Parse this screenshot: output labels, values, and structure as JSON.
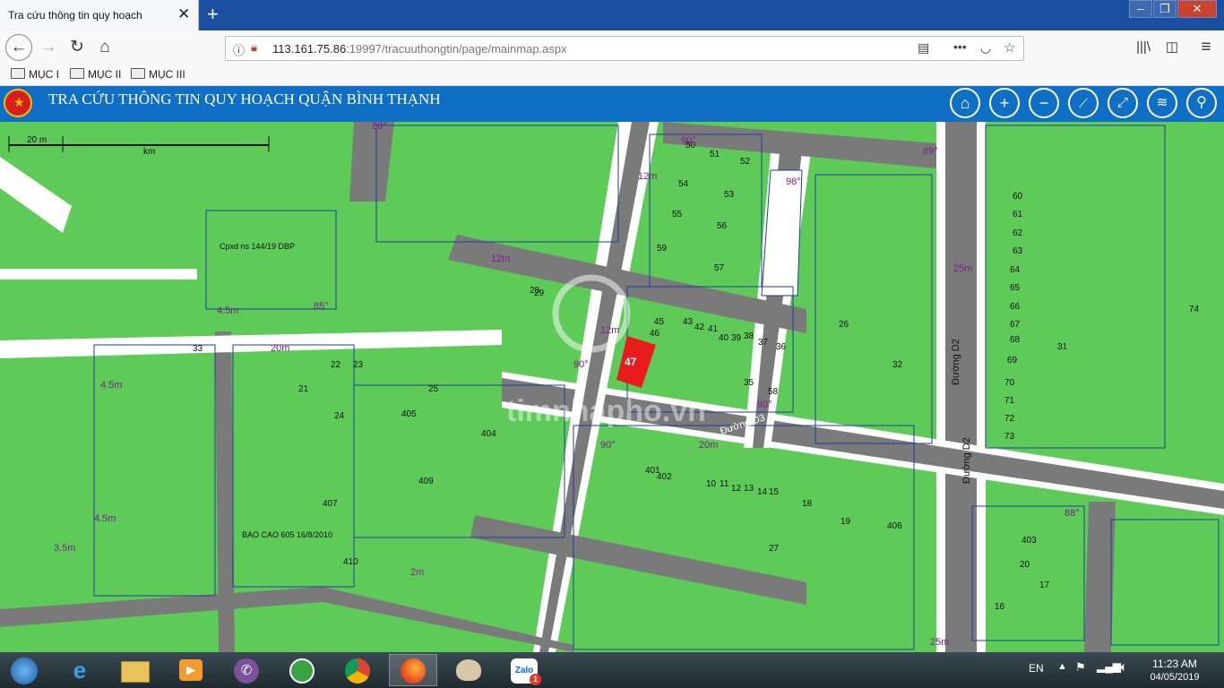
{
  "browser": {
    "tab_title": "Tra cứu thông tin quy hoạch",
    "tab_close": "✕",
    "new_tab": "+",
    "url_host": "113.161.75.86",
    "url_rest": ":19997/tracuuthongtin/page/mainmap.aspx",
    "bookmarks": [
      "MỤC I",
      "MỤC II",
      "MỤC III"
    ],
    "nav_icons": [
      "back-icon",
      "forward-icon",
      "reload-icon",
      "home-icon"
    ],
    "right_icons": [
      "reader-view-icon",
      "more-icon",
      "pocket-icon",
      "star-icon",
      "library-icon",
      "sidebar-icon",
      "menu-icon"
    ]
  },
  "site": {
    "title": "TRA CỨU THÔNG TIN QUY HOẠCH QUẬN BÌNH THẠNH",
    "tools": [
      "home-icon",
      "zoom-in-icon",
      "zoom-out-icon",
      "ruler-icon",
      "fullscreen-icon",
      "layers-icon",
      "search-icon"
    ]
  },
  "map": {
    "scale_label": "20 m",
    "scale_label2": "km",
    "watermark": "timnhapho.vn",
    "highlight_lot": "47",
    "roads": [
      "Đường D2",
      "Đường D3",
      "Đường D2"
    ],
    "labels": [
      "Cpxd ns 144/19 DBP",
      "BAO CAO 605 16/8/2010",
      "4.5m",
      "4.5m",
      "4.5m",
      "3.5m",
      "2m",
      "20m",
      "25m",
      "25m",
      "12m",
      "12m",
      "20m",
      "12m",
      "88°",
      "85°",
      "90°",
      "90°",
      "89°",
      "90°",
      "90°",
      "98°",
      "88°"
    ],
    "lot_numbers": [
      "50",
      "51",
      "52",
      "53",
      "54",
      "55",
      "56",
      "57",
      "58",
      "59",
      "45",
      "46",
      "43",
      "42",
      "41",
      "40",
      "39",
      "38",
      "37",
      "36",
      "35",
      "33",
      "32",
      "31",
      "29",
      "28",
      "27",
      "26",
      "25",
      "24",
      "23",
      "22",
      "21",
      "20",
      "19",
      "18",
      "17",
      "16",
      "15",
      "14",
      "13",
      "12",
      "11",
      "10",
      "406",
      "405",
      "404",
      "403",
      "402",
      "401",
      "409",
      "410",
      "407",
      "74",
      "73",
      "72",
      "71",
      "70",
      "69",
      "68",
      "67",
      "66",
      "65",
      "64",
      "63",
      "62",
      "61",
      "60"
    ]
  },
  "taskbar": {
    "apps": [
      "windows-start-icon",
      "internet-explorer-icon",
      "file-explorer-icon",
      "media-player-icon",
      "viber-icon",
      "coccoc-icon",
      "chrome-icon",
      "firefox-icon",
      "paint-icon",
      "zalo-icon"
    ],
    "zalo_label": "Zalo",
    "zalo_badge": "1",
    "lang": "EN",
    "time": "11:23 AM",
    "date": "04/05/2019"
  }
}
